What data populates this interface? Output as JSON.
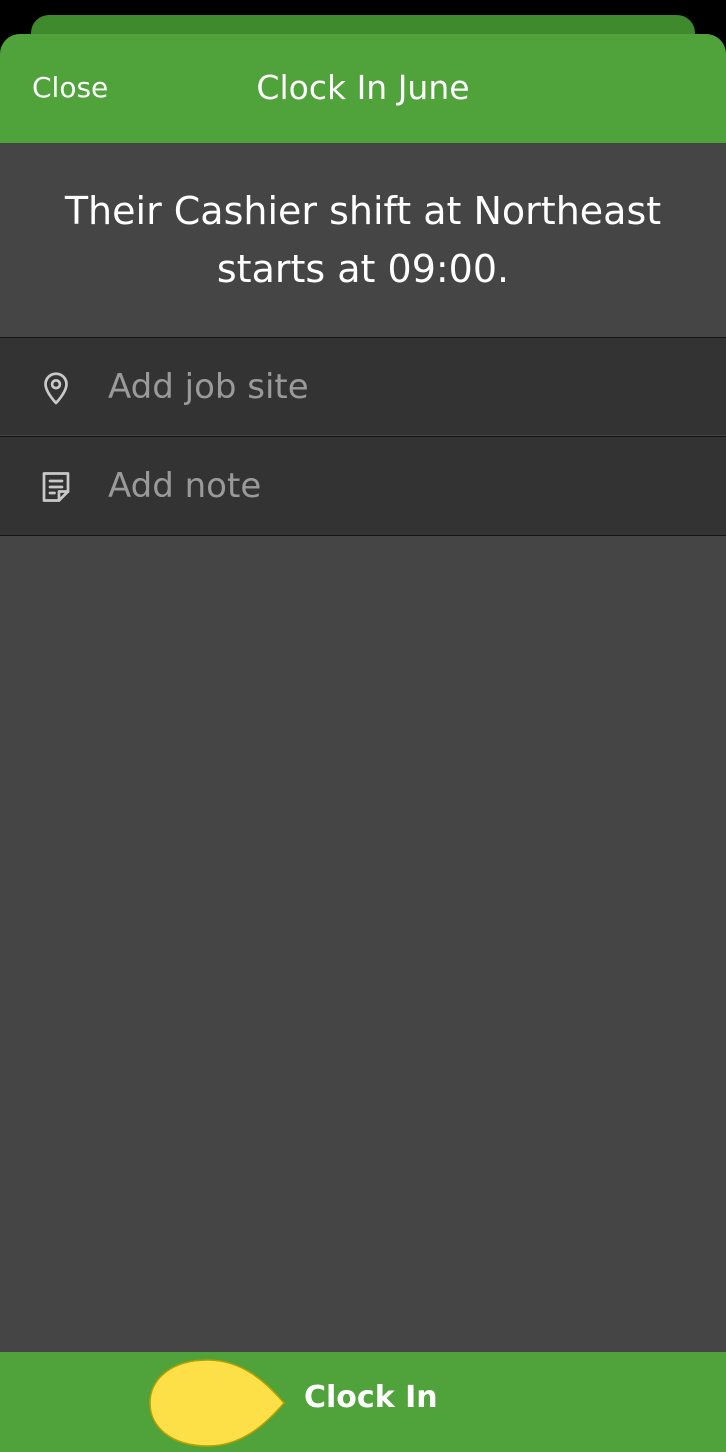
{
  "header": {
    "close_label": "Close",
    "title": "Clock In June"
  },
  "shift_info": {
    "text": "Their Cashier shift at Northeast starts at 09:00."
  },
  "fields": {
    "job_site": {
      "placeholder": "Add job site",
      "icon": "location-pin-icon"
    },
    "note": {
      "placeholder": "Add note",
      "icon": "note-icon"
    }
  },
  "footer": {
    "clock_in_label": "Clock In",
    "pointer_icon": "pointer-hint-icon"
  },
  "colors": {
    "header_green": "#50a23b",
    "back_card_green": "#3f8a2c",
    "panel_gray": "#454545",
    "row_gray": "#333333",
    "placeholder_gray": "#9a9a9a",
    "pointer_yellow": "#fde047"
  }
}
